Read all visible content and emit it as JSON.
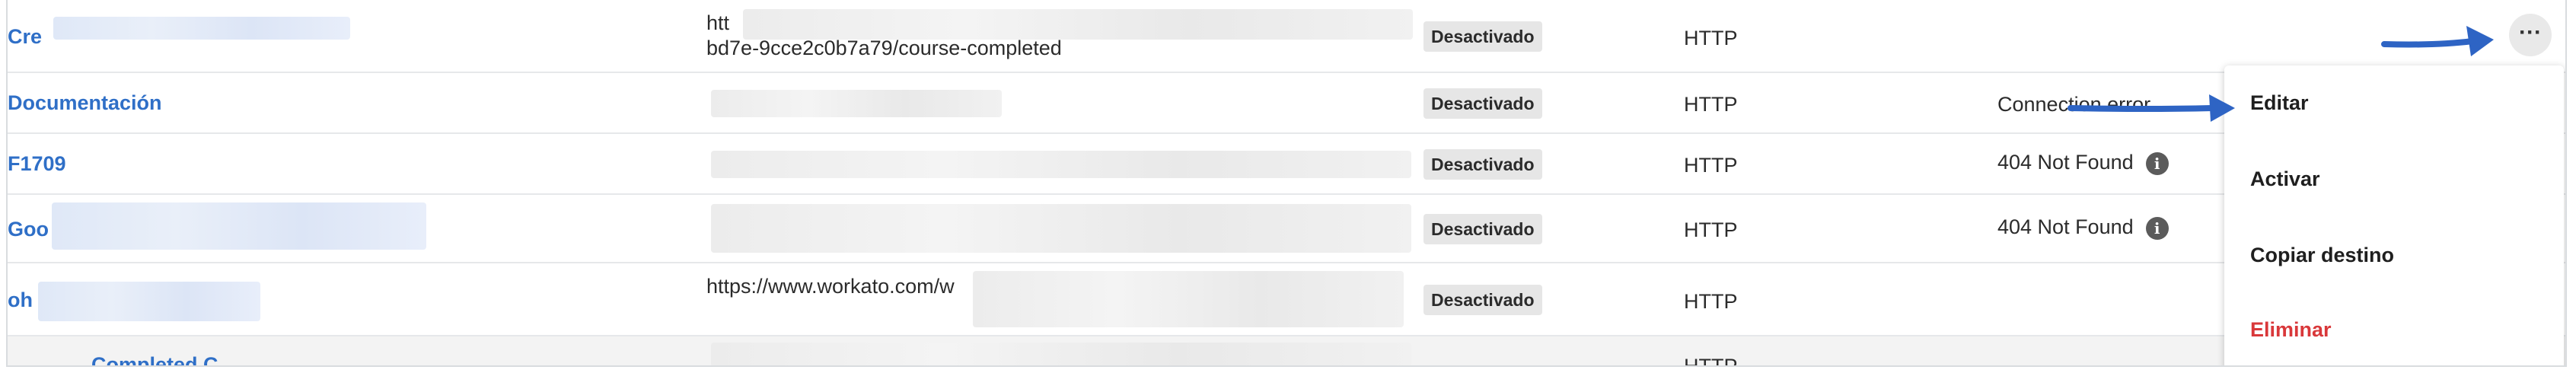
{
  "rows": [
    {
      "name": "Cre",
      "url_line1": "htt",
      "url_line2": "bd7e-9cce2c0b7a79/course-completed",
      "status": "Desactivado",
      "protocol": "HTTP",
      "error": ""
    },
    {
      "name": "Documentación",
      "url_line1": "",
      "url_line2": "",
      "status": "Desactivado",
      "protocol": "HTTP",
      "error": "Connection error"
    },
    {
      "name": "F1709",
      "url_line1": "",
      "url_line2": "",
      "status": "Desactivado",
      "protocol": "HTTP",
      "error": "404 Not Found"
    },
    {
      "name": "Goo",
      "url_line1": "",
      "url_line2": "",
      "status": "Desactivado",
      "protocol": "HTTP",
      "error": "404 Not Found"
    },
    {
      "name": "oh",
      "url_line1": "https://www.workato.com/w",
      "url_line2": "",
      "status": "Desactivado",
      "protocol": "HTTP",
      "error": ""
    },
    {
      "name": "Completed C",
      "url_line1": "",
      "url_line2": "",
      "status": "",
      "protocol": "HTTP",
      "error": ""
    }
  ],
  "more_button": "···",
  "info_icon": "i",
  "menu": {
    "items": [
      {
        "label": "Editar"
      },
      {
        "label": "Activar"
      },
      {
        "label": "Copiar destino"
      },
      {
        "label": "Eliminar"
      }
    ]
  },
  "colors": {
    "link": "#2f6fc7",
    "danger": "#d9383a",
    "arrow": "#2e64c4",
    "badge_bg": "#e6e6e6"
  },
  "icons": [
    "info-icon",
    "more-horizontal-icon",
    "arrow-annotation-icon"
  ]
}
